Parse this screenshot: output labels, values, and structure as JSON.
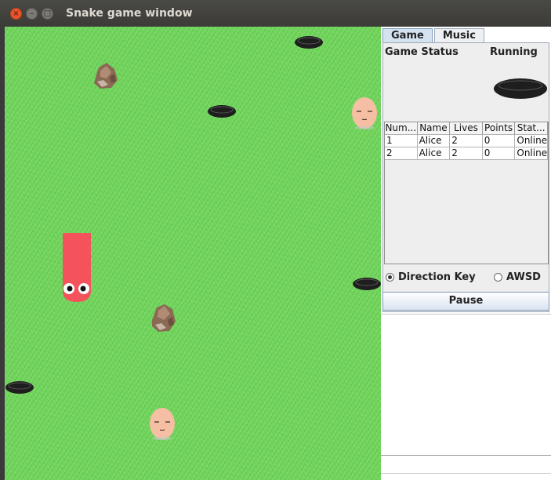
{
  "window": {
    "title": "Snake game window",
    "controls": {
      "close": "×",
      "minimize": "–",
      "maximize": "□"
    }
  },
  "tabs": [
    {
      "label": "Game",
      "active": true
    },
    {
      "label": "Music",
      "active": false
    }
  ],
  "game_status": {
    "label": "Game Status",
    "value": "Running"
  },
  "players_table": {
    "columns": [
      "Num...",
      "Name",
      "Lives",
      "Points",
      "Stat..."
    ],
    "rows": [
      [
        "1",
        "Alice",
        "2",
        "0",
        "Online"
      ],
      [
        "2",
        "Alice",
        "2",
        "0",
        "Online"
      ]
    ]
  },
  "controls": {
    "direction_key_label": "Direction Key",
    "awsd_label": "AWSD",
    "selected": "Direction Key",
    "pause_label": "Pause"
  },
  "colors": {
    "grass": "#6fd45a",
    "snake": "#f5535b",
    "hole": "#1e1e1e",
    "tab_active": "#d5e3f1"
  },
  "sprites": [
    {
      "type": "hole-icon"
    },
    {
      "type": "rock-icon"
    },
    {
      "type": "hole-icon"
    },
    {
      "type": "egg-icon"
    },
    {
      "type": "snake"
    },
    {
      "type": "hole-icon"
    },
    {
      "type": "rock-icon"
    },
    {
      "type": "hole-icon"
    },
    {
      "type": "egg-icon"
    }
  ]
}
